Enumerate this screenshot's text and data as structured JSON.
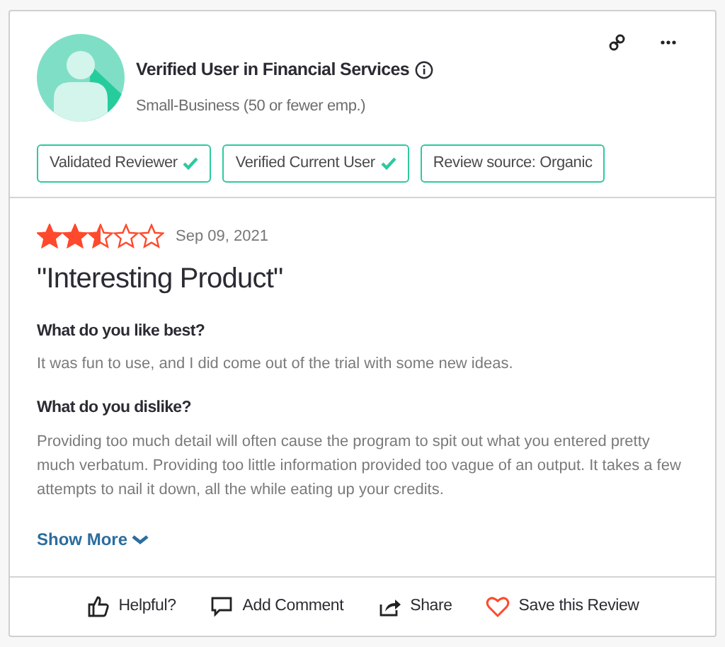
{
  "reviewer": {
    "name": "Verified User in Financial Services",
    "segment": "Small-Business (50 or fewer emp.)"
  },
  "badges": [
    {
      "label": "Validated Reviewer",
      "checked": true
    },
    {
      "label": "Verified Current User",
      "checked": true
    },
    {
      "label": "Review source: Organic",
      "checked": false
    }
  ],
  "review": {
    "stars": 2.5,
    "date": "Sep 09, 2021",
    "title": "\"Interesting Product\"",
    "sections": [
      {
        "question": "What do you like best?",
        "answer": "It was fun to use, and I did come out of the trial with some new ideas."
      },
      {
        "question": "What do you dislike?",
        "answer": "Providing too much detail will often cause the program to spit out what you entered pretty much verbatum. Providing too little information provided too vague of an output. It takes a few attempts to nail it down, all the while eating up your credits."
      }
    ],
    "show_more": "Show More"
  },
  "actions": [
    {
      "kind": "helpful",
      "label": "Helpful?"
    },
    {
      "kind": "comment",
      "label": "Add Comment"
    },
    {
      "kind": "share",
      "label": "Share"
    },
    {
      "kind": "save",
      "label": "Save this Review"
    }
  ]
}
